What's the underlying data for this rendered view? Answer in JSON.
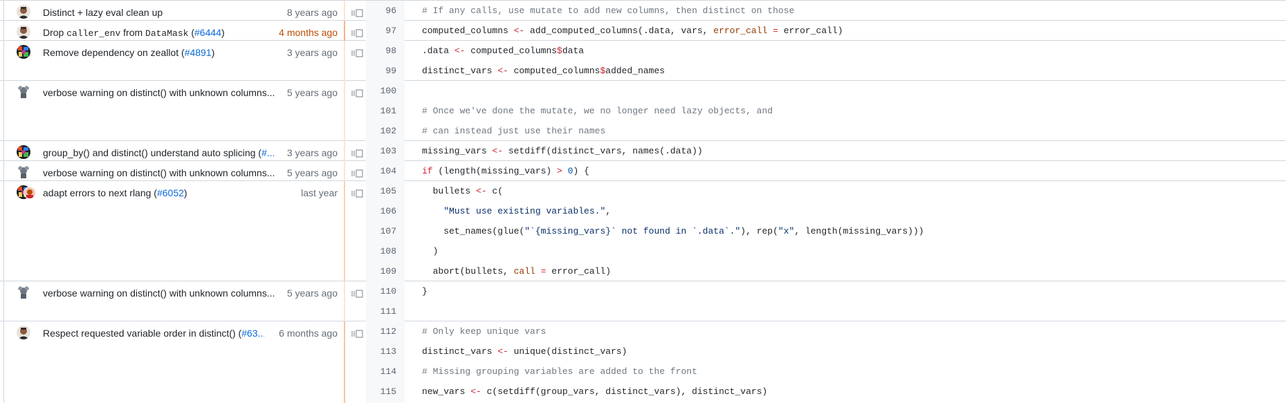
{
  "commits": [
    {
      "message": "Distinct + lazy eval clean up",
      "age": "8 years ago",
      "avatar": "avatar-photo-man"
    },
    {
      "message_parts": [
        "Drop ",
        "caller_env",
        " from ",
        "DataMask",
        " (",
        "#6444",
        ")"
      ],
      "age": "4 months ago",
      "avatar": "avatar-photo-man"
    },
    {
      "message_prefix": "Remove dependency on zeallot (",
      "issue": "#4891",
      "message_suffix": ")",
      "age": "3 years ago",
      "avatar": "avatar-multicolor"
    },
    {
      "message": "verbose warning on distinct() with unknown columns...",
      "age": "5 years ago",
      "avatar": "avatar-mascot"
    },
    {
      "message_prefix": "group_by() and distinct() understand auto splicing (",
      "issue": "#...",
      "age": "3 years ago",
      "avatar": "avatar-multicolor"
    },
    {
      "message": "verbose warning on distinct() with unknown columns...",
      "age": "5 years ago",
      "avatar": "avatar-mascot"
    },
    {
      "message_prefix": "adapt errors to next rlang (",
      "issue": "#6052",
      "message_suffix": ")",
      "age": "last year",
      "avatar": "avatar-multicolor-pair"
    },
    {
      "message": "verbose warning on distinct() with unknown columns...",
      "age": "5 years ago",
      "avatar": "avatar-mascot"
    },
    {
      "message_prefix": "Respect requested variable order in distinct() (",
      "issue": "#63...",
      "age": "6 months ago",
      "avatar": "avatar-photo-man"
    }
  ],
  "lines": [
    {
      "num": "96",
      "tokens": [
        {
          "t": "# If any calls, use mutate to add new columns, then distinct on those",
          "c": "c"
        }
      ]
    },
    {
      "num": "97",
      "tokens": [
        {
          "t": "computed_columns "
        },
        {
          "t": "<-",
          "c": "k"
        },
        {
          "t": " add_computed_columns(.data, vars, "
        },
        {
          "t": "error_call",
          "c": "a"
        },
        {
          "t": " "
        },
        {
          "t": "=",
          "c": "k"
        },
        {
          "t": " error_call)"
        }
      ]
    },
    {
      "num": "98",
      "tokens": [
        {
          "t": ".data "
        },
        {
          "t": "<-",
          "c": "k"
        },
        {
          "t": " computed_columns"
        },
        {
          "t": "$",
          "c": "k"
        },
        {
          "t": "data"
        }
      ]
    },
    {
      "num": "99",
      "tokens": [
        {
          "t": "distinct_vars "
        },
        {
          "t": "<-",
          "c": "k"
        },
        {
          "t": " computed_columns"
        },
        {
          "t": "$",
          "c": "k"
        },
        {
          "t": "added_names"
        }
      ]
    },
    {
      "num": "100",
      "tokens": []
    },
    {
      "num": "101",
      "tokens": [
        {
          "t": "# Once we've done the mutate, we no longer need lazy objects, and",
          "c": "c"
        }
      ]
    },
    {
      "num": "102",
      "tokens": [
        {
          "t": "# can instead just use their names",
          "c": "c"
        }
      ]
    },
    {
      "num": "103",
      "tokens": [
        {
          "t": "missing_vars "
        },
        {
          "t": "<-",
          "c": "k"
        },
        {
          "t": " setdiff(distinct_vars, names(.data))"
        }
      ]
    },
    {
      "num": "104",
      "tokens": [
        {
          "t": "if",
          "c": "k"
        },
        {
          "t": " (length(missing_vars) "
        },
        {
          "t": ">",
          "c": "k"
        },
        {
          "t": " "
        },
        {
          "t": "0",
          "c": "n"
        },
        {
          "t": ") {"
        }
      ]
    },
    {
      "num": "105",
      "tokens": [
        {
          "t": "  bullets "
        },
        {
          "t": "<-",
          "c": "k"
        },
        {
          "t": " c("
        }
      ]
    },
    {
      "num": "106",
      "tokens": [
        {
          "t": "    "
        },
        {
          "t": "\"Must use existing variables.\"",
          "c": "s"
        },
        {
          "t": ","
        }
      ]
    },
    {
      "num": "107",
      "tokens": [
        {
          "t": "    set_names(glue("
        },
        {
          "t": "\"`{missing_vars}` not found in `.data`.\"",
          "c": "s"
        },
        {
          "t": "), rep("
        },
        {
          "t": "\"x\"",
          "c": "s"
        },
        {
          "t": ", length(missing_vars)))"
        }
      ]
    },
    {
      "num": "108",
      "tokens": [
        {
          "t": "  )"
        }
      ]
    },
    {
      "num": "109",
      "tokens": [
        {
          "t": "  abort(bullets, "
        },
        {
          "t": "call",
          "c": "a"
        },
        {
          "t": " "
        },
        {
          "t": "=",
          "c": "k"
        },
        {
          "t": " error_call)"
        }
      ]
    },
    {
      "num": "110",
      "tokens": [
        {
          "t": "}"
        }
      ]
    },
    {
      "num": "111",
      "tokens": []
    },
    {
      "num": "112",
      "tokens": [
        {
          "t": "# Only keep unique vars",
          "c": "c"
        }
      ]
    },
    {
      "num": "113",
      "tokens": [
        {
          "t": "distinct_vars "
        },
        {
          "t": "<-",
          "c": "k"
        },
        {
          "t": " unique(distinct_vars)"
        }
      ]
    },
    {
      "num": "114",
      "tokens": [
        {
          "t": "# Missing grouping variables are added to the front",
          "c": "c"
        }
      ]
    },
    {
      "num": "115",
      "tokens": [
        {
          "t": "new_vars "
        },
        {
          "t": "<-",
          "c": "k"
        },
        {
          "t": " c(setdiff(group_vars, distinct_vars), distinct_vars)"
        }
      ]
    }
  ],
  "colors": {
    "border": "#d0d7de",
    "heat": "#f7b28a",
    "link": "#0969da",
    "muted": "#656d76"
  }
}
